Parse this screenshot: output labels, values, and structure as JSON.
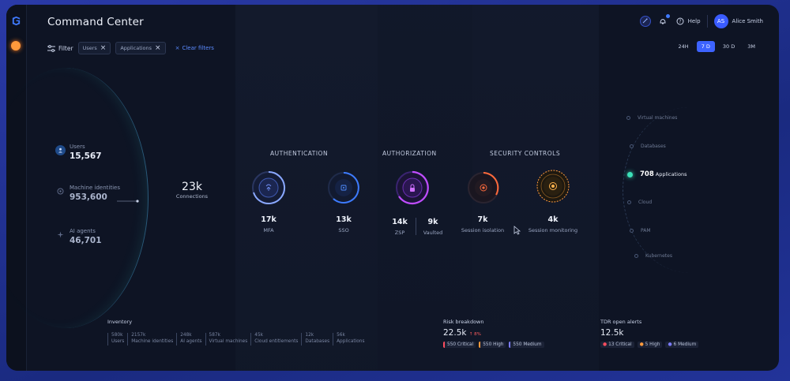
{
  "app": {
    "title": "Command Center"
  },
  "filter": {
    "label": "Filter",
    "chips": [
      "Users",
      "Applications"
    ],
    "clear": "Clear filters"
  },
  "header": {
    "help": "Help",
    "avatar_initials": "AS",
    "user_name": "Alice Smith"
  },
  "time_range": {
    "options": [
      "24H",
      "7 D",
      "30 D",
      "3M"
    ],
    "selected": "7 D"
  },
  "left_stats": [
    {
      "label": "Users",
      "value": "15,567"
    },
    {
      "label": "Machine identities",
      "value": "953,600"
    },
    {
      "label": "AI agents",
      "value": "46,701"
    }
  ],
  "connections": {
    "value": "23k",
    "label": "Connections"
  },
  "sections": {
    "authentication": "AUTHENTICATION",
    "authorization": "AUTHORIZATION",
    "security": "SECURITY CONTROLS"
  },
  "metrics": {
    "mfa": {
      "value": "17k",
      "label": "MFA"
    },
    "sso": {
      "value": "13k",
      "label": "SSO"
    },
    "zsp": {
      "value": "14k",
      "label": "ZSP"
    },
    "vaulted": {
      "value": "9k",
      "label": "Vaulted"
    },
    "session_isolation": {
      "value": "7k",
      "label": "Session isolation"
    },
    "session_monitoring": {
      "value": "4k",
      "label": "Session monitoring"
    }
  },
  "targets": [
    {
      "label": "Virtual machines"
    },
    {
      "label": "Databases"
    },
    {
      "label": "Applications",
      "value": "708",
      "active": true
    },
    {
      "label": "Cloud"
    },
    {
      "label": "PAM"
    },
    {
      "label": "Kubernetes"
    }
  ],
  "inventory": {
    "title": "Inventory",
    "cells": [
      {
        "value": "580k",
        "label": "Users"
      },
      {
        "value": "2157k",
        "label": "Machine identities"
      },
      {
        "value": "248k",
        "label": "AI agents"
      },
      {
        "value": "587k",
        "label": "Virtual machines"
      },
      {
        "value": "45k",
        "label": "Cloud entitlements"
      },
      {
        "value": "12k",
        "label": "Databases"
      },
      {
        "value": "56k",
        "label": "Applications"
      }
    ]
  },
  "risk": {
    "title": "Risk breakdown",
    "value": "22.5k",
    "delta": "↑ 8%",
    "tags": [
      "550 Critical",
      "550 High",
      "550 Medium"
    ]
  },
  "tdr": {
    "title": "TDR open alerts",
    "value": "12.5k",
    "tags": [
      "13 Critical",
      "5 High",
      "6 Medium"
    ]
  },
  "colors": {
    "accent": "#3d63ff",
    "teal": "#3ce0b8",
    "orange": "#ff9a3c",
    "violet": "#c04dff",
    "critical": "#ff4d5e",
    "high": "#ff9a3c",
    "medium": "#7b7bff"
  }
}
